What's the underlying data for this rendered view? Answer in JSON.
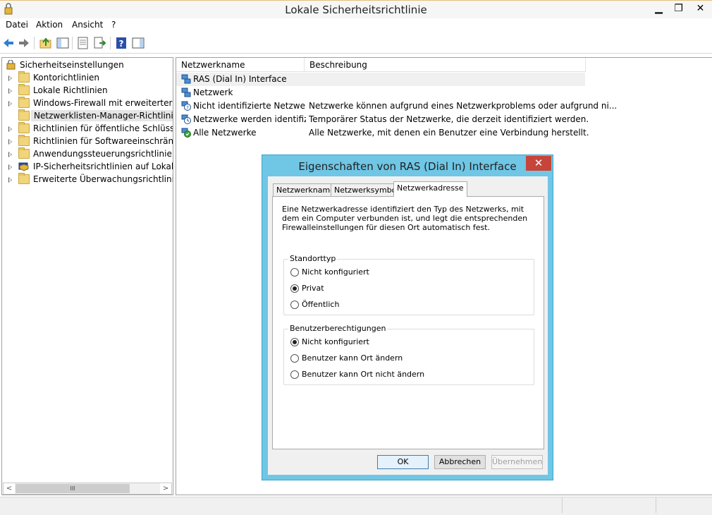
{
  "window": {
    "title": "Lokale Sicherheitsrichtlinie",
    "minimize": "▁",
    "maximize": "❐",
    "close": "✕"
  },
  "menu": {
    "items": [
      "Datei",
      "Aktion",
      "Ansicht",
      "?"
    ]
  },
  "toolbar": {
    "icons": [
      "back-arrow-icon",
      "forward-arrow-icon",
      "up-folder-icon",
      "show-hide-tree-icon",
      "properties-icon",
      "export-list-icon",
      "help-icon",
      "action-pane-icon"
    ]
  },
  "tree": {
    "root": "Sicherheitseinstellungen",
    "items": [
      {
        "label": "Kontorichtlinien",
        "icon": "folder-lock-icon"
      },
      {
        "label": "Lokale Richtlinien",
        "icon": "folder-lock-icon"
      },
      {
        "label": "Windows-Firewall mit erweiterter Sicherheit",
        "icon": "folder-icon"
      },
      {
        "label": "Netzwerklisten-Manager-Richtlinien",
        "icon": "folder-icon"
      },
      {
        "label": "Richtlinien für öffentliche Schlüssel",
        "icon": "folder-icon"
      },
      {
        "label": "Richtlinien für Softwareeinschränkung",
        "icon": "folder-icon"
      },
      {
        "label": "Anwendungssteuerungsrichtlinien",
        "icon": "folder-icon"
      },
      {
        "label": "IP-Sicherheitsrichtlinien auf Lokaler Computer",
        "icon": "ipsec-shield-icon"
      },
      {
        "label": "Erweiterte Überwachungsrichtlinienkonfiguration",
        "icon": "folder-icon"
      }
    ],
    "scroll_thumb": "III",
    "scroll_left": "<",
    "scroll_right": ">"
  },
  "list": {
    "columns": [
      "Netzwerkname",
      "Beschreibung"
    ],
    "rows": [
      {
        "name": "RAS (Dial In) Interface",
        "desc": ""
      },
      {
        "name": "Netzwerk",
        "desc": ""
      },
      {
        "name": "Nicht identifizierte Netzwerke",
        "desc": "Netzwerke können aufgrund eines Netzwerkproblems oder aufgrund ni..."
      },
      {
        "name": "Netzwerke werden identifizi...",
        "desc": "Temporärer Status der Netzwerke, die derzeit identifiziert werden."
      },
      {
        "name": "Alle Netzwerke",
        "desc": "Alle Netzwerke, mit denen ein Benutzer eine Verbindung herstellt."
      }
    ]
  },
  "dialog": {
    "title": "Eigenschaften von RAS (Dial In) Interface",
    "close": "✕",
    "tabs": [
      "Netzwerkname",
      "Netzwerksymbol",
      "Netzwerkadresse"
    ],
    "active_tab": "Netzwerkadresse",
    "description": "Eine Netzwerkadresse identifiziert den Typ des Netzwerks, mit dem ein Computer verbunden ist, und legt die entsprechenden Firewalleinstellungen für diesen Ort automatisch fest.",
    "location_group": {
      "legend": "Standorttyp",
      "options": [
        "Nicht konfiguriert",
        "Privat",
        "Öffentlich"
      ],
      "selected": "Privat"
    },
    "permissions_group": {
      "legend": "Benutzerberechtigungen",
      "options": [
        "Nicht konfiguriert",
        "Benutzer kann Ort ändern",
        "Benutzer kann Ort nicht ändern"
      ],
      "selected": "Nicht konfiguriert"
    },
    "buttons": {
      "ok": "OK",
      "cancel": "Abbrechen",
      "apply": "Übernehmen"
    }
  },
  "colors": {
    "dialog_frame": "#6fc6e5",
    "dialog_close": "#c7443a",
    "folder": "#f2d47a"
  }
}
